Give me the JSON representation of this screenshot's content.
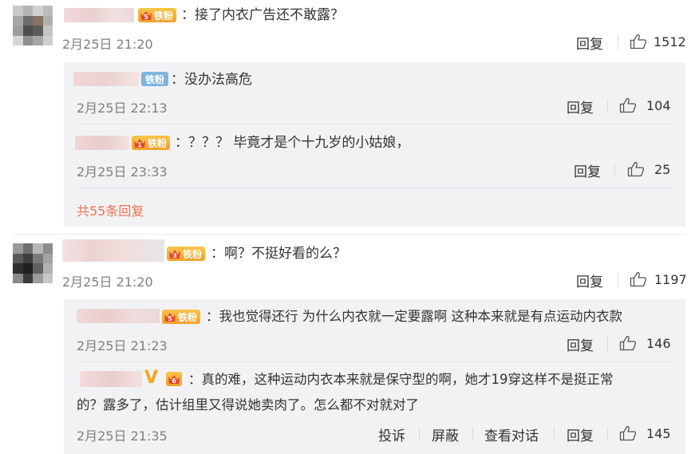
{
  "colors": {
    "accent": "#eb7350",
    "sub_bg": "#f2f2f5",
    "time": "#808080",
    "badge_gold": "#f1a02b",
    "badge_blue": "#7fb3e0"
  },
  "comments": [
    {
      "badge_level": "5",
      "badge_text": "铁粉",
      "text": "：接了内衣广告还不敢露？",
      "time": "2月25日 21:20",
      "reply_label": "回复",
      "likes": "1512",
      "replies": [
        {
          "badge_text": "铁粉",
          "text": "：没办法高危",
          "time": "2月25日 22:13",
          "reply_label": "回复",
          "likes": "104"
        },
        {
          "badge_level": "1",
          "badge_text": "铁粉",
          "text": "：？？？ 毕竟才是个十九岁的小姑娘，",
          "time": "2月25日 23:33",
          "reply_label": "回复",
          "likes": "25"
        }
      ],
      "more_label": "共55条回复"
    },
    {
      "badge_level": "3",
      "badge_text": "铁粉",
      "text": "：啊？不挺好看的么？",
      "time": "2月25日 21:20",
      "reply_label": "回复",
      "likes": "1197",
      "replies": [
        {
          "badge_level": "5",
          "badge_text": "铁粉",
          "text": "：我也觉得还行 为什么内衣就一定要露啊 这种本来就是有点运动内衣款",
          "time": "2月25日 21:23",
          "reply_label": "回复",
          "likes": "146"
        },
        {
          "verified_mark": "V",
          "badge_level": "6",
          "text_line1": "：真的难，这种运动内衣本来就是保守型的啊，她才19穿这样不是挺正常",
          "text_line2": "的？露多了，估计组里又得说她卖肉了。怎么都不对就对了",
          "time": "2月25日 21:35",
          "report_label": "投诉",
          "block_label": "屏蔽",
          "conversation_label": "查看对话",
          "reply_label": "回复",
          "likes": "145"
        }
      ]
    }
  ]
}
